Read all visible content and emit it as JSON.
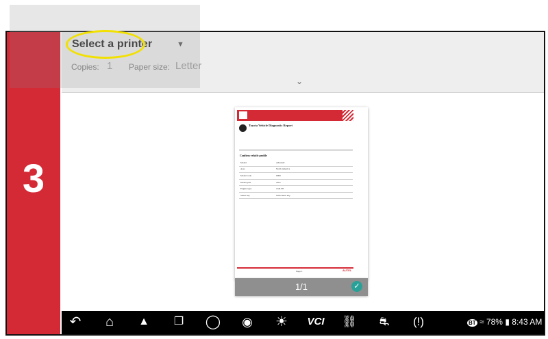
{
  "step": {
    "number": "3"
  },
  "print_settings": {
    "printer_select_label": "Select a printer",
    "copies_label": "Copies:",
    "copies_value": "1",
    "paper_size_label": "Paper size:",
    "paper_size_value": "Letter"
  },
  "preview": {
    "page_counter": "1/1",
    "document": {
      "title": "Toyota Vehicle Diagnostic Report",
      "section_title": "Confirm vehicle profile",
      "rows": [
        {
          "label": "Model",
          "value": "Allstandr"
        },
        {
          "label": "Area",
          "value": "North America"
        },
        {
          "label": "Model code",
          "value": "0000"
        },
        {
          "label": "Model year",
          "value": "2021"
        },
        {
          "label": "Engine type",
          "value": "1GR-FE"
        },
        {
          "label": "Smart key",
          "value": "With smart key"
        }
      ],
      "footer_page": "Page 1",
      "brand": "AUTEL"
    }
  },
  "taskbar": {
    "icons": [
      "back-icon",
      "home-icon",
      "workshop-icon",
      "recent-apps-icon",
      "browser-icon",
      "camera-icon",
      "brightness-icon",
      "vci-icon",
      "vehicle-icon",
      "vehicle-profile-icon",
      "tpms-icon"
    ],
    "vci_label": "VCI",
    "status": {
      "bluetooth": "BT",
      "battery": "78%",
      "time": "8:43 AM"
    }
  },
  "colors": {
    "accent_red": "#d42a35",
    "highlight_yellow": "#f2e000",
    "check_teal": "#2aa198"
  }
}
